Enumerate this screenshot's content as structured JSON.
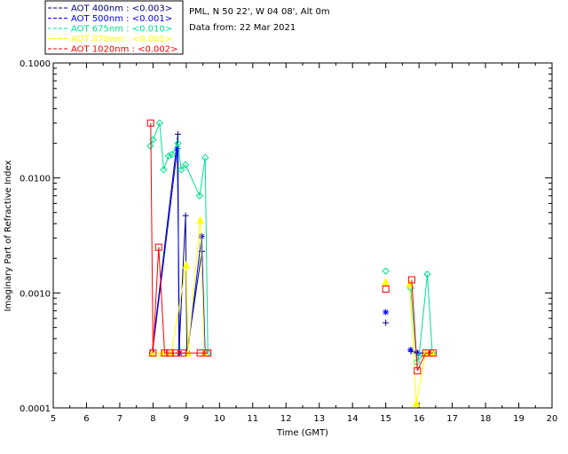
{
  "info": {
    "site": "PML, N 50 22', W 04 08', Alt 0m",
    "date": "Data from: 22 Mar 2021"
  },
  "chart_data": {
    "type": "line",
    "title": "",
    "xlabel": "Time (GMT)",
    "ylabel": "Imaginary Part of Refractive Index",
    "xlim": [
      5,
      20
    ],
    "ylim": [
      0.0001,
      0.1
    ],
    "yscale": "log",
    "xticks": [
      "5",
      "6",
      "7",
      "8",
      "9",
      "10",
      "11",
      "12",
      "13",
      "14",
      "15",
      "16",
      "17",
      "18",
      "19",
      "20"
    ],
    "yticks": [
      "0.0001",
      "0.0010",
      "0.0100",
      "0.1000"
    ],
    "legend_position": "top-left outside",
    "series": [
      {
        "name": "AOT  400nm : <0.003>",
        "color": "#000080",
        "marker": "plus",
        "segments": [
          [
            [
              7.97,
              0.0003
            ],
            [
              8.75,
              0.024
            ],
            [
              8.78,
              0.0003
            ],
            [
              8.98,
              0.0047
            ],
            [
              9.02,
              0.0003
            ],
            [
              9.47,
              0.0023
            ],
            [
              9.55,
              0.0003
            ]
          ],
          [
            [
              15.0,
              0.00055
            ]
          ],
          [
            [
              15.76,
              0.00031
            ],
            [
              15.95,
              0.0003
            ],
            [
              16.35,
              0.0003
            ]
          ]
        ]
      },
      {
        "name": "AOT  500nm : <0.001>",
        "color": "#0000ff",
        "marker": "star",
        "segments": [
          [
            [
              7.98,
              0.0003
            ],
            [
              8.73,
              0.018
            ],
            [
              8.8,
              0.0003
            ],
            [
              9.04,
              0.0003
            ],
            [
              9.46,
              0.0031
            ],
            [
              9.57,
              0.0003
            ]
          ],
          [
            [
              15.0,
              0.00068
            ]
          ],
          [
            [
              15.75,
              0.00032
            ],
            [
              15.97,
              0.0003
            ],
            [
              16.35,
              0.0003
            ]
          ]
        ]
      },
      {
        "name": "AOT  675nm : <0.010>",
        "color": "#00e090",
        "marker": "diamond",
        "segments": [
          [
            [
              7.92,
              0.019
            ],
            [
              8.0,
              0.0215
            ],
            [
              8.2,
              0.03
            ],
            [
              8.32,
              0.0118
            ],
            [
              8.47,
              0.0155
            ],
            [
              8.57,
              0.016
            ],
            [
              8.75,
              0.02
            ],
            [
              8.85,
              0.0118
            ],
            [
              8.98,
              0.013
            ],
            [
              9.4,
              0.007
            ],
            [
              9.57,
              0.015
            ],
            [
              9.65,
              0.0003
            ]
          ],
          [
            [
              15.0,
              0.00155
            ]
          ],
          [
            [
              15.75,
              0.0011
            ],
            [
              15.93,
              0.00025
            ],
            [
              16.0,
              0.00028
            ],
            [
              16.25,
              0.00145
            ],
            [
              16.4,
              0.0003
            ]
          ]
        ]
      },
      {
        "name": "AOT  870nm : <0.001>",
        "color": "#ffff00",
        "marker": "triangle",
        "segments": [
          [
            [
              7.97,
              0.0003
            ],
            [
              8.27,
              0.0003
            ],
            [
              8.55,
              0.0003
            ],
            [
              9.0,
              0.00175
            ],
            [
              9.05,
              0.0003
            ],
            [
              9.42,
              0.0043
            ],
            [
              9.55,
              0.0003
            ]
          ],
          [
            [
              15.0,
              0.00125
            ]
          ],
          [
            [
              15.72,
              0.0012
            ],
            [
              15.92,
              0.00011
            ],
            [
              16.2,
              0.0003
            ],
            [
              16.4,
              0.0003
            ]
          ]
        ]
      },
      {
        "name": "AOT 1020nm : <0.002>",
        "color": "#ff0000",
        "marker": "square",
        "segments": [
          [
            [
              7.93,
              0.03
            ],
            [
              8.0,
              0.0003
            ],
            [
              8.17,
              0.0025
            ],
            [
              8.35,
              0.0003
            ],
            [
              8.5,
              0.0003
            ],
            [
              8.7,
              0.0003
            ],
            [
              8.9,
              0.0003
            ],
            [
              9.42,
              0.0003
            ],
            [
              9.65,
              0.0003
            ]
          ],
          [
            [
              15.0,
              0.00108
            ]
          ],
          [
            [
              15.78,
              0.0013
            ],
            [
              15.95,
              0.00021
            ],
            [
              16.2,
              0.0003
            ],
            [
              16.42,
              0.0003
            ]
          ]
        ]
      }
    ]
  }
}
